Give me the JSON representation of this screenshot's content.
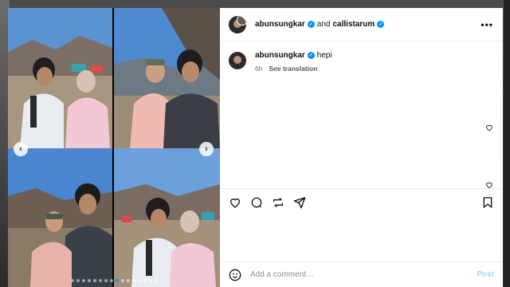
{
  "post": {
    "author": "abunsungkar",
    "conjunction": "and",
    "collaborator": "callistarum",
    "caption_text": "hepi",
    "time_ago": "6h",
    "see_translation": "See translation"
  },
  "icons": {
    "more": "more-options-icon",
    "like": "heart-icon",
    "comment": "comment-icon",
    "repost": "repost-icon",
    "share": "share-icon",
    "save": "bookmark-icon",
    "emoji": "emoji-icon",
    "verified": "verified-badge-icon"
  },
  "comment_box": {
    "placeholder": "Add a comment…",
    "post_label": "Post"
  },
  "carousel": {
    "prev": "‹",
    "next": "›",
    "slide_count": 16,
    "active_index": 8
  },
  "colors": {
    "accent": "#0095f6",
    "post_disabled": "#a6d2f7",
    "dot_active": "#1a8cff"
  }
}
